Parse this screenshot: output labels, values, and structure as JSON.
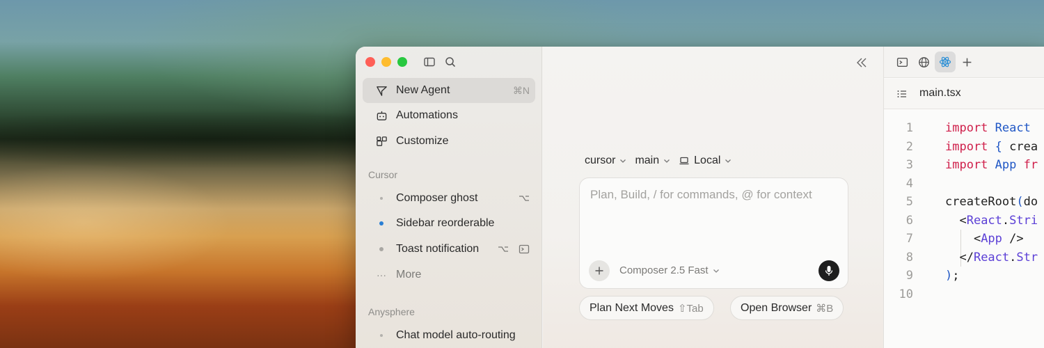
{
  "colors": {
    "accent_dot": "#2a7fd4",
    "keyword": "#cf1f4a",
    "tag": "#5b3fd6",
    "mic_bg": "#1e1e1e"
  },
  "sidebar": {
    "nav": [
      {
        "label": "New Agent",
        "icon": "send-icon",
        "shortcut": "⌘N"
      },
      {
        "label": "Automations",
        "icon": "robot-icon"
      },
      {
        "label": "Customize",
        "icon": "blocks-icon"
      }
    ],
    "sections": [
      {
        "label": "Cursor",
        "items": [
          {
            "label": "Composer ghost",
            "status": "idle",
            "trail": [
              "branch-icon"
            ]
          },
          {
            "label": "Sidebar reorderable",
            "status": "active"
          },
          {
            "label": "Toast notification",
            "status": "idle-filled",
            "trail": [
              "branch-icon",
              "terminal-icon"
            ]
          },
          {
            "label": "More",
            "status": "more"
          }
        ]
      },
      {
        "label": "Anysphere",
        "items": [
          {
            "label": "Chat model auto-routing",
            "status": "idle"
          }
        ]
      }
    ]
  },
  "main": {
    "selectors": {
      "repo": "cursor",
      "branch": "main",
      "env": "Local"
    },
    "composer": {
      "placeholder": "Plan, Build, / for commands, @ for context",
      "model": "Composer 2.5 Fast"
    },
    "chips": [
      {
        "label": "Plan Next Moves",
        "kbd": "⇧Tab"
      },
      {
        "label": "Open Browser",
        "kbd": "⌘B"
      }
    ]
  },
  "editor": {
    "toolbar_icons": [
      "terminal-icon",
      "globe-icon",
      "react-icon",
      "plus-icon"
    ],
    "filename": "main.tsx",
    "lines": [
      "1",
      "2",
      "3",
      "4",
      "5",
      "6",
      "7",
      "8",
      "9",
      "10"
    ]
  }
}
